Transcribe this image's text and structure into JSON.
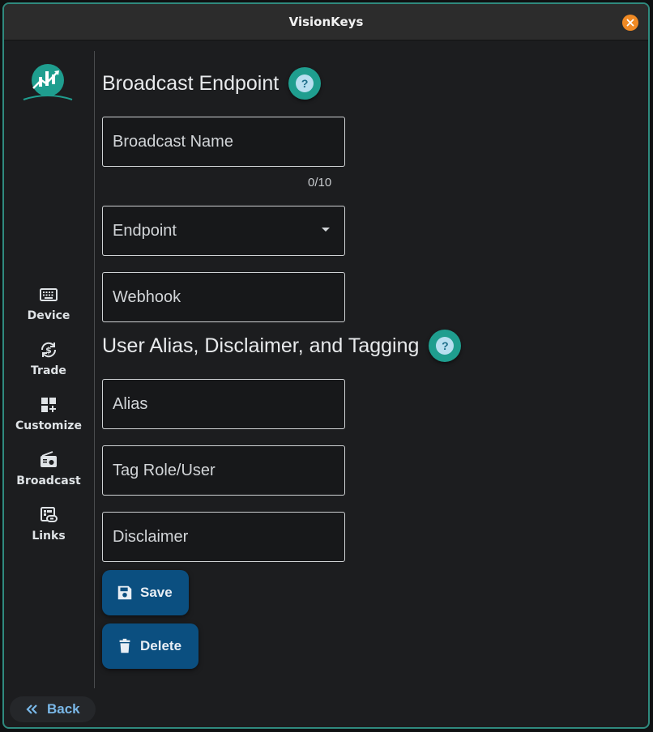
{
  "window": {
    "title": "VisionKeys"
  },
  "sidebar": {
    "items": [
      {
        "label": "Device",
        "icon": "keyboard-icon"
      },
      {
        "label": "Trade",
        "icon": "currency-exchange-icon"
      },
      {
        "label": "Customize",
        "icon": "dashboard-add-icon"
      },
      {
        "label": "Broadcast",
        "icon": "radio-icon"
      },
      {
        "label": "Links",
        "icon": "link-card-icon"
      }
    ],
    "back_label": "Back"
  },
  "broadcast": {
    "title": "Broadcast Endpoint",
    "name_placeholder": "Broadcast Name",
    "name_counter": "0/10",
    "endpoint_placeholder": "Endpoint",
    "webhook_placeholder": "Webhook"
  },
  "user": {
    "title": "User Alias, Disclaimer, and Tagging",
    "alias_placeholder": "Alias",
    "tag_placeholder": "Tag Role/User",
    "disclaimer_placeholder": "Disclaimer"
  },
  "actions": {
    "save_label": "Save",
    "delete_label": "Delete"
  },
  "colors": {
    "accent": "#1f9e8f",
    "button": "#0b4f80",
    "window_border": "#2f8a7e",
    "close": "#f08a24",
    "link": "#7ab8e8"
  }
}
